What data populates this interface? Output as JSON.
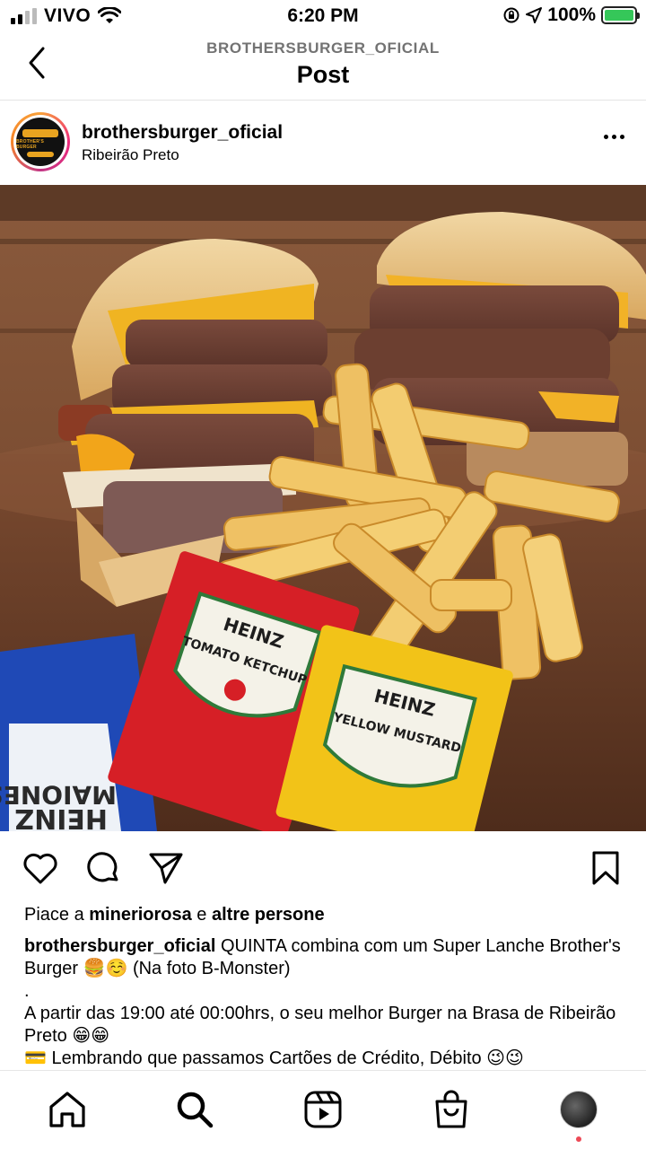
{
  "status_bar": {
    "carrier": "VIVO",
    "time": "6:20 PM",
    "battery_percent": "100%",
    "icons": [
      "signal-icon",
      "wifi-icon",
      "screen-lock-icon",
      "location-icon",
      "battery-charging-icon"
    ]
  },
  "header": {
    "account": "BROTHERSBURGER_OFICIAL",
    "title": "Post"
  },
  "post": {
    "username": "brothersburger_oficial",
    "location": "Ribeirão Preto",
    "likes_prefix": "Piace a ",
    "likes_user": "mineriorosa",
    "likes_middle": " e ",
    "likes_others": "altre persone",
    "caption_user": "brothersburger_oficial",
    "caption_line1": " QUINTA combina com um Super Lanche Brother's Burger 🍔☺️ (Na foto B-Monster)",
    "caption_line2": ".",
    "caption_line3": "A partir das 19:00 até 00:00hrs, o seu melhor Burger na Brasa de Ribeirão Preto 😁😁",
    "caption_line4": "💳 Lembrando que passamos Cartões de Crédito, Débito 😉😉"
  },
  "photo_labels": {
    "ketchup_brand": "HEINZ",
    "ketchup_name": "TOMATO KETCHUP",
    "mustard_brand": "HEINZ",
    "mustard_name": "YELLOW MUSTARD",
    "mayo_brand": "HEINZ",
    "mayo_name": "MAIONESE"
  },
  "bottom_nav": [
    "home-icon",
    "search-icon",
    "reels-icon",
    "shop-icon",
    "profile-avatar"
  ]
}
